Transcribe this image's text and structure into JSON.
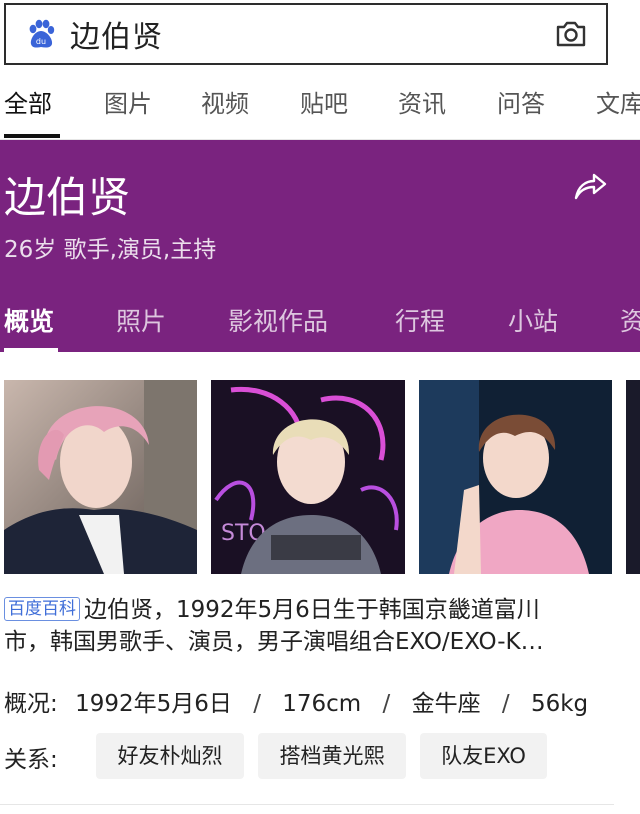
{
  "search": {
    "query": "边伯贤"
  },
  "tabs": [
    {
      "label": "全部",
      "active": true
    },
    {
      "label": "图片"
    },
    {
      "label": "视频"
    },
    {
      "label": "贴吧"
    },
    {
      "label": "资讯"
    },
    {
      "label": "问答"
    },
    {
      "label": "文库"
    }
  ],
  "card": {
    "name": "边伯贤",
    "subtitle": "26岁 歌手,演员,主持",
    "background_color": "#7a237f",
    "tabs": [
      {
        "label": "概览",
        "active": true
      },
      {
        "label": "照片"
      },
      {
        "label": "影视作品"
      },
      {
        "label": "行程"
      },
      {
        "label": "小站"
      },
      {
        "label": "资"
      }
    ]
  },
  "photos": [
    {
      "name": "photo-pink-hair"
    },
    {
      "name": "photo-blonde-hair"
    },
    {
      "name": "photo-pink-shirt"
    }
  ],
  "info": {
    "source_badge": "百度百科",
    "description_line1": "边伯贤，1992年5月6日生于韩国京畿道富川",
    "description_line2": "市，韩国男歌手、演员，男子演唱组合EXO/EXO-K…",
    "overview_label": "概况:",
    "overview_items": [
      "1992年5月6日",
      "176cm",
      "金牛座",
      "56kg"
    ],
    "overview_separator": "/",
    "relations_label": "关系:",
    "relations": [
      "好友朴灿烈",
      "搭档黄光熙",
      "队友EXO"
    ]
  }
}
